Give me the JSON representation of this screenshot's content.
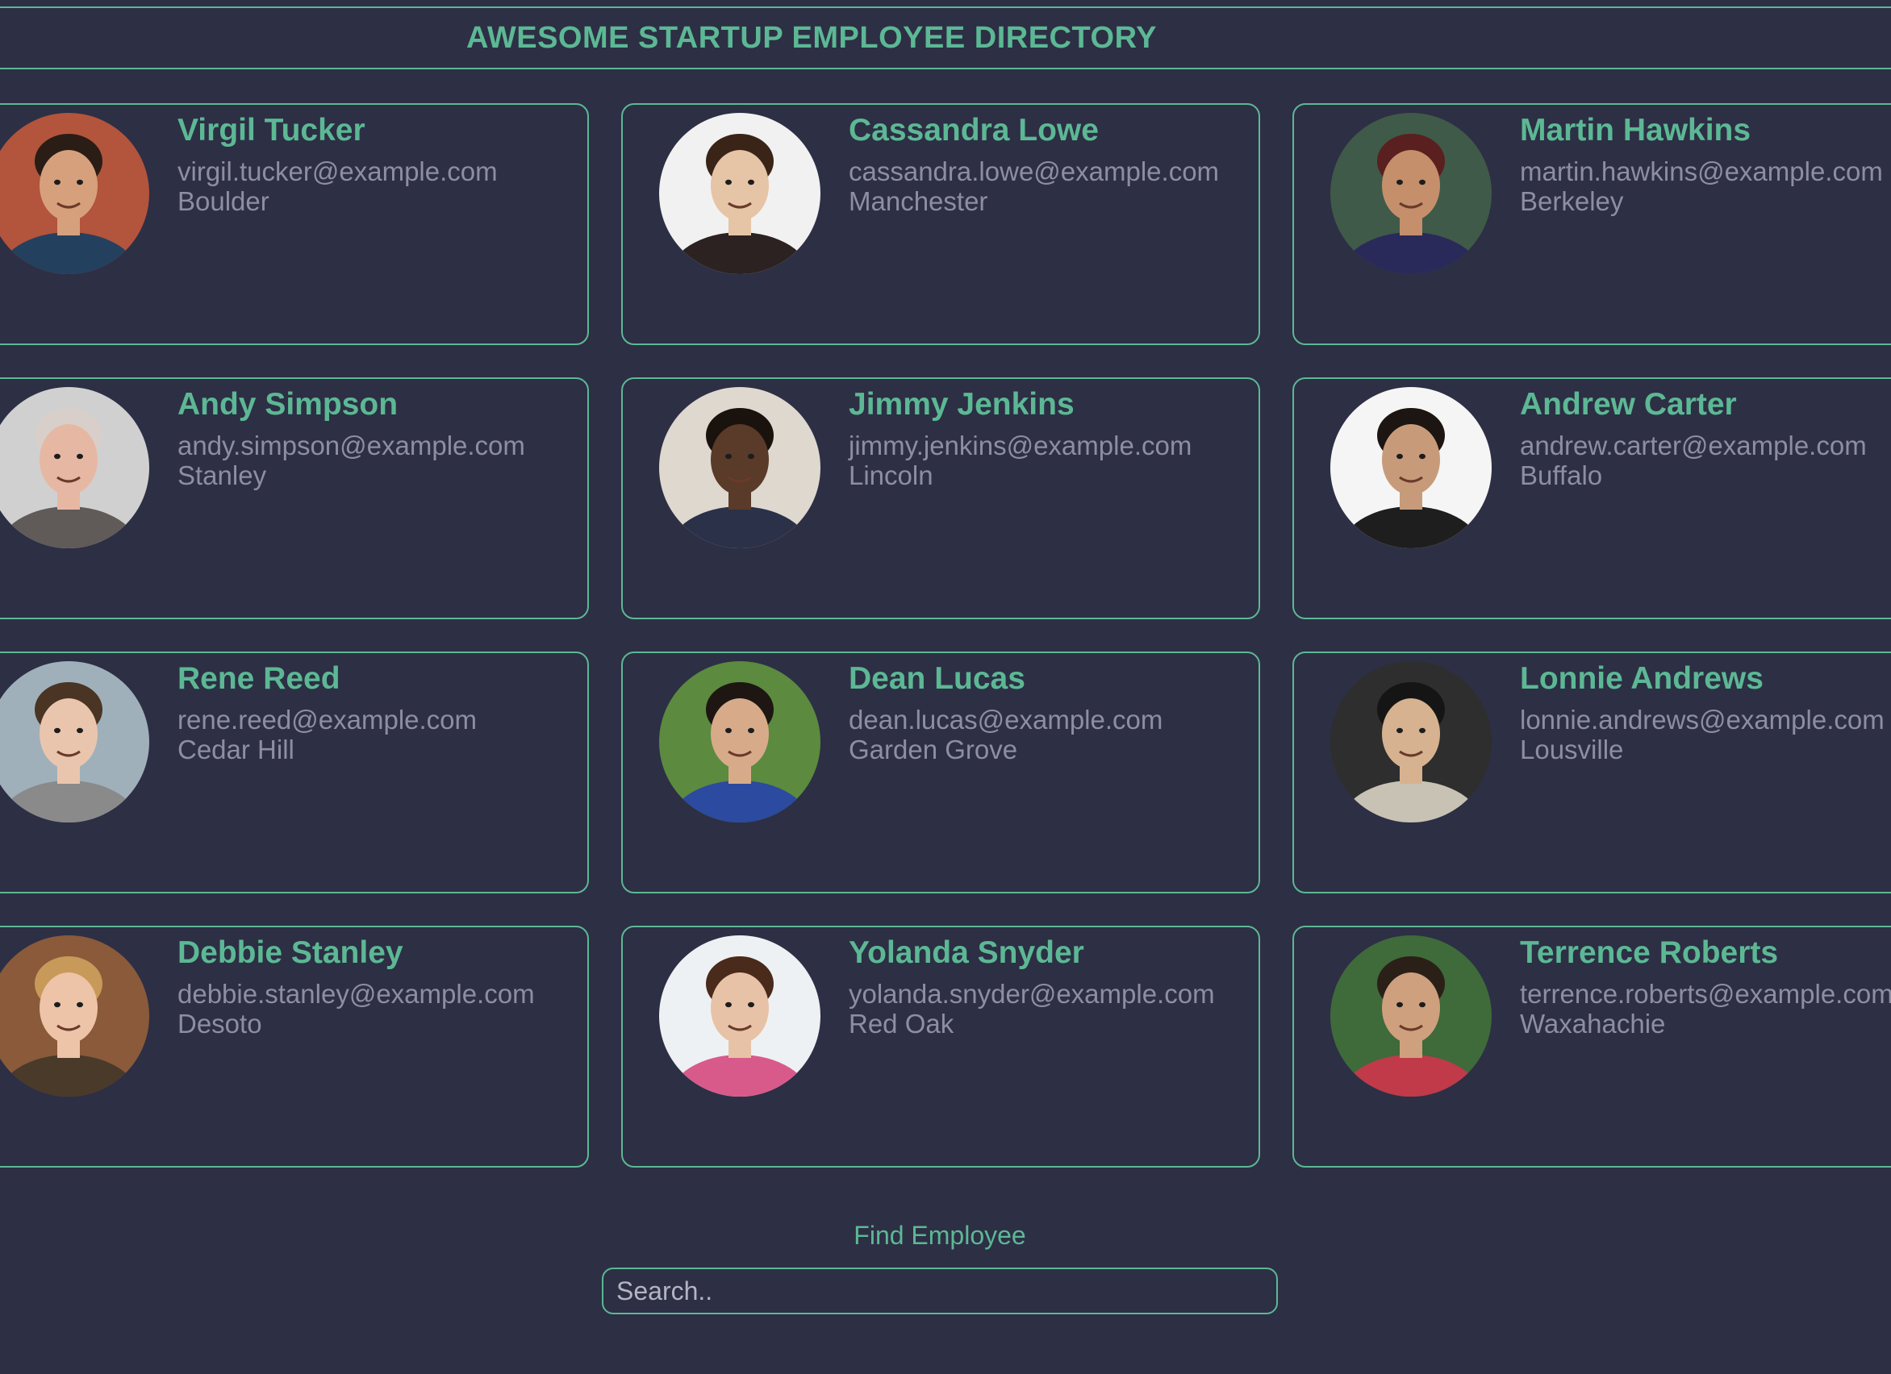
{
  "header": {
    "title": "AWESOME STARTUP EMPLOYEE DIRECTORY"
  },
  "employees": [
    {
      "name": "Virgil Tucker",
      "email": "virgil.tucker@example.com",
      "city": "Boulder",
      "skin": "#d7a07c",
      "hair": "#2a1d16",
      "shirt": "#24405f",
      "bg": "#b3543c"
    },
    {
      "name": "Cassandra Lowe",
      "email": "cassandra.lowe@example.com",
      "city": "Manchester",
      "skin": "#e6c4a6",
      "hair": "#3a2418",
      "shirt": "#2b2221",
      "bg": "#f1f1f1"
    },
    {
      "name": "Martin Hawkins",
      "email": "martin.hawkins@example.com",
      "city": "Berkeley",
      "skin": "#c58f6c",
      "hair": "#5a1f1f",
      "shirt": "#2a2a5a",
      "bg": "#3f5a48"
    },
    {
      "name": "Andy Simpson",
      "email": "andy.simpson@example.com",
      "city": "Stanley",
      "skin": "#e6b8a4",
      "hair": "#d8cfca",
      "shirt": "#605a58",
      "bg": "#d0d0d0"
    },
    {
      "name": "Jimmy Jenkins",
      "email": "jimmy.jenkins@example.com",
      "city": "Lincoln",
      "skin": "#5a3a28",
      "hair": "#1a120d",
      "shirt": "#2b3148",
      "bg": "#ded8cf"
    },
    {
      "name": "Andrew Carter",
      "email": "andrew.carter@example.com",
      "city": "Buffalo",
      "skin": "#c79b7a",
      "hair": "#1c1512",
      "shirt": "#1e1e1e",
      "bg": "#f5f5f5"
    },
    {
      "name": "Rene Reed",
      "email": "rene.reed@example.com",
      "city": "Cedar Hill",
      "skin": "#eac5ad",
      "hair": "#4a3424",
      "shirt": "#8a8a8a",
      "bg": "#9fb0ba"
    },
    {
      "name": "Dean Lucas",
      "email": "dean.lucas@example.com",
      "city": "Garden Grove",
      "skin": "#d7ab8a",
      "hair": "#1e1612",
      "shirt": "#2b4aa0",
      "bg": "#5c8a3f"
    },
    {
      "name": "Lonnie Andrews",
      "email": "lonnie.andrews@example.com",
      "city": "Lousville",
      "skin": "#d6b290",
      "hair": "#151515",
      "shirt": "#c8c2b5",
      "bg": "#2e2e2e"
    },
    {
      "name": "Debbie Stanley",
      "email": "debbie.stanley@example.com",
      "city": "Desoto",
      "skin": "#edc4a8",
      "hair": "#c89a5a",
      "shirt": "#4a3a2a",
      "bg": "#8a5a3a"
    },
    {
      "name": "Yolanda Snyder",
      "email": "yolanda.snyder@example.com",
      "city": "Red Oak",
      "skin": "#e8c2a6",
      "hair": "#4a2a1a",
      "shirt": "#d85a8a",
      "bg": "#eef1f3"
    },
    {
      "name": "Terrence Roberts",
      "email": "terrence.roberts@example.com",
      "city": "Waxahachie",
      "skin": "#cfa07e",
      "hair": "#2a2018",
      "shirt": "#c03a4a",
      "bg": "#3f6a3a"
    }
  ],
  "search": {
    "label": "Find Employee",
    "placeholder": "Search.."
  }
}
